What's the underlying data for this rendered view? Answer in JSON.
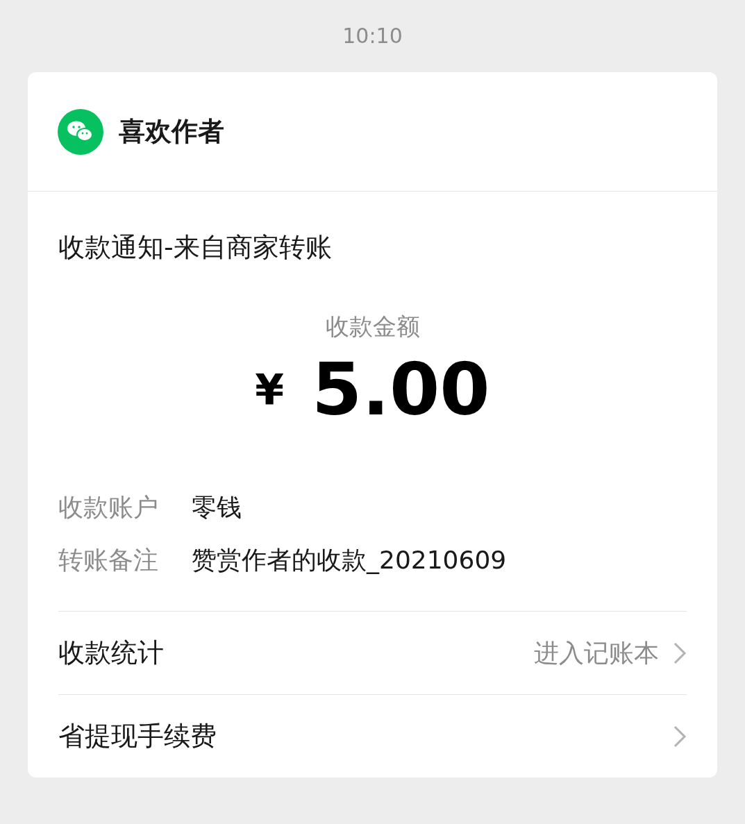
{
  "time": "10:10",
  "card": {
    "sender": "喜欢作者",
    "title": "收款通知-来自商家转账",
    "amount_label": "收款金额",
    "currency": "¥",
    "amount": "5.00",
    "details": [
      {
        "label": "收款账户",
        "value": "零钱"
      },
      {
        "label": "转账备注",
        "value": "赞赏作者的收款_20210609"
      }
    ],
    "links": [
      {
        "label": "收款统计",
        "hint": "进入记账本"
      },
      {
        "label": "省提现手续费"
      }
    ]
  }
}
